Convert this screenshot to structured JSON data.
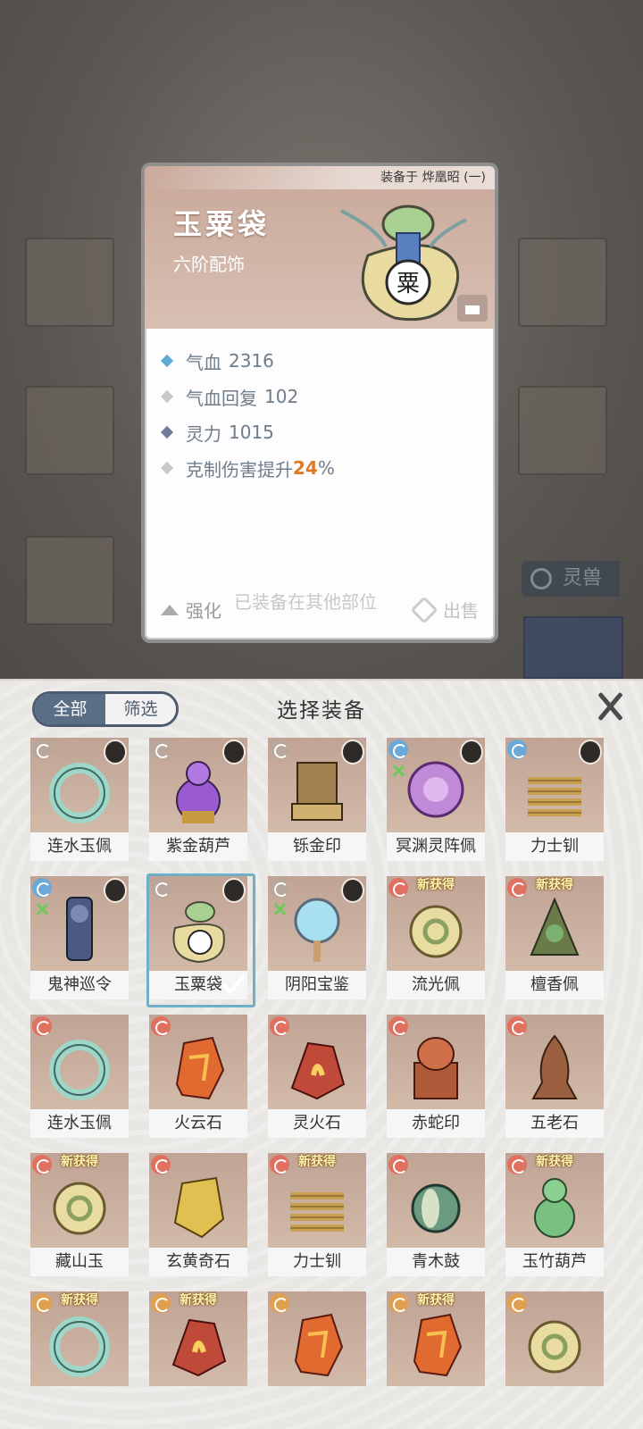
{
  "detail": {
    "equipped_to": "装备于 烨凰昭 (一)",
    "name": "玉粟袋",
    "grade": "六阶配饰",
    "bag_glyph": "粟",
    "attributes": [
      {
        "label": "气血",
        "value": "2316",
        "color": "#5fa9d6"
      },
      {
        "label": "气血回复",
        "value": "102",
        "color": "#c9c9c9"
      },
      {
        "label": "灵力",
        "value": "1015",
        "color": "#6f7d9a"
      },
      {
        "label": "克制伤害提升",
        "value": "24",
        "suffix": "%",
        "color": "#c9c9c9"
      }
    ],
    "enhance_label": "强化",
    "other_slot_label": "已装备在其他部位",
    "sell_label": "出售"
  },
  "background": {
    "tab_label": "灵兽"
  },
  "panel": {
    "title": "选择装备",
    "filter_all": "全部",
    "filter_screen": "筛选",
    "new_label": "新获得",
    "items": [
      {
        "name": "连水玉佩",
        "badge": "#b8a79a",
        "hero": true,
        "art": "ring-jade"
      },
      {
        "name": "紫金葫芦",
        "badge": "#b8a79a",
        "hero": true,
        "art": "gourd-purple"
      },
      {
        "name": "铄金印",
        "badge": "#b8a79a",
        "hero": true,
        "art": "seal-gold"
      },
      {
        "name": "冥渊灵阵佩",
        "badge": "#6ca8d8",
        "hero": true,
        "mark": true,
        "art": "orb-purple"
      },
      {
        "name": "力士钏",
        "badge": "#6ca8d8",
        "hero": true,
        "art": "coil-gold"
      },
      {
        "name": "鬼神巡令",
        "badge": "#6ca8d8",
        "hero": true,
        "mark": true,
        "art": "token-dark"
      },
      {
        "name": "玉粟袋",
        "badge": "#b8a79a",
        "hero": true,
        "selected": true,
        "art": "bag"
      },
      {
        "name": "阴阳宝鉴",
        "badge": "#b8a79a",
        "hero": true,
        "mark": true,
        "art": "mirror"
      },
      {
        "name": "流光佩",
        "badge": "#e07060",
        "new": true,
        "art": "disc-jade"
      },
      {
        "name": "檀香佩",
        "badge": "#e07060",
        "new": true,
        "art": "pendant-green"
      },
      {
        "name": "连水玉佩",
        "badge": "#e07060",
        "art": "ring-jade"
      },
      {
        "name": "火云石",
        "badge": "#e07060",
        "art": "rock-fire"
      },
      {
        "name": "灵火石",
        "badge": "#e07060",
        "art": "rock-red"
      },
      {
        "name": "赤蛇印",
        "badge": "#e07060",
        "art": "seal-red"
      },
      {
        "name": "五老石",
        "badge": "#e07060",
        "art": "rock-brown"
      },
      {
        "name": "藏山玉",
        "badge": "#e07060",
        "new": true,
        "art": "disc-jade"
      },
      {
        "name": "玄黄奇石",
        "badge": "#e07060",
        "art": "rock-gold"
      },
      {
        "name": "力士钏",
        "badge": "#e07060",
        "new": true,
        "art": "coil-gold"
      },
      {
        "name": "青木鼓",
        "badge": "#e07060",
        "art": "drum"
      },
      {
        "name": "玉竹葫芦",
        "badge": "#e07060",
        "new": true,
        "art": "gourd-green"
      },
      {
        "name": "",
        "badge": "#e0a050",
        "new": true,
        "art": "ring-jade"
      },
      {
        "name": "",
        "badge": "#e0a050",
        "new": true,
        "art": "rock-red"
      },
      {
        "name": "",
        "badge": "#e0a050",
        "art": "rock-fire"
      },
      {
        "name": "",
        "badge": "#e0a050",
        "new": true,
        "art": "rock-fire"
      },
      {
        "name": "",
        "badge": "#e0a050",
        "art": "disc-jade"
      }
    ]
  }
}
